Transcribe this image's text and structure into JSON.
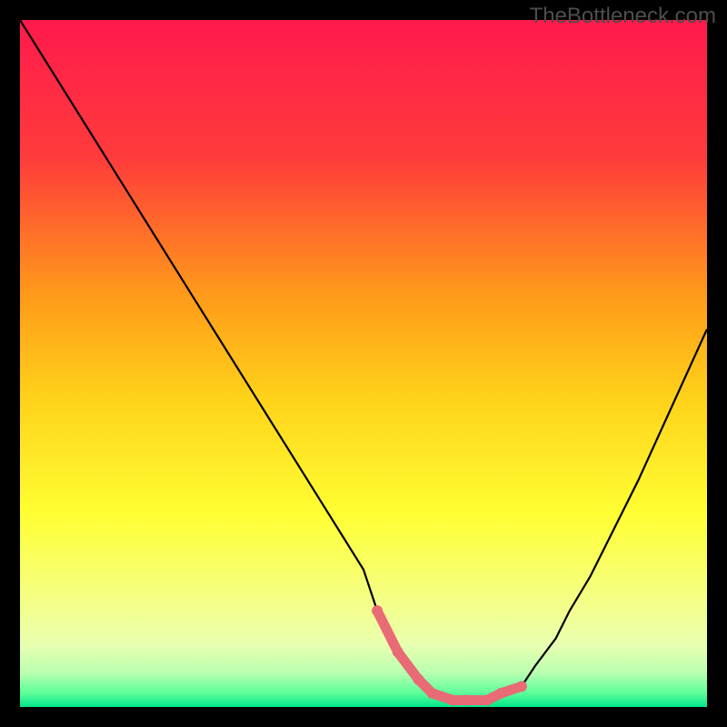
{
  "watermark": "TheBottleneck.com",
  "chart_data": {
    "type": "line",
    "title": "",
    "xlabel": "",
    "ylabel": "",
    "xlim": [
      0,
      100
    ],
    "ylim": [
      0,
      100
    ],
    "grid": false,
    "legend": false,
    "series": [
      {
        "name": "bottleneck-curve",
        "x": [
          0,
          5,
          10,
          15,
          20,
          25,
          30,
          35,
          40,
          45,
          50,
          52,
          55,
          58,
          60,
          63,
          65,
          68,
          70,
          73,
          75,
          78,
          80,
          83,
          86,
          90,
          95,
          100
        ],
        "values": [
          100,
          92,
          84,
          76,
          68,
          60,
          52,
          44,
          36,
          28,
          20,
          14,
          8,
          4,
          2,
          1,
          1,
          1,
          2,
          3,
          6,
          10,
          14,
          19,
          25,
          33,
          44,
          55
        ]
      }
    ],
    "good_zone_markers": {
      "x": [
        52,
        55,
        58,
        60,
        63,
        65,
        68,
        70,
        73
      ],
      "values": [
        14,
        8,
        4,
        2,
        1,
        1,
        1,
        2,
        3
      ]
    },
    "background_gradient_stops": [
      {
        "pos": 0.0,
        "color": "#ff1a4d"
      },
      {
        "pos": 0.2,
        "color": "#ff3b3b"
      },
      {
        "pos": 0.4,
        "color": "#ff9a1a"
      },
      {
        "pos": 0.55,
        "color": "#ffd21a"
      },
      {
        "pos": 0.72,
        "color": "#ffff33"
      },
      {
        "pos": 0.85,
        "color": "#f4ff8a"
      },
      {
        "pos": 0.91,
        "color": "#e9ffb0"
      },
      {
        "pos": 0.95,
        "color": "#baffb0"
      },
      {
        "pos": 0.98,
        "color": "#5cff9a"
      },
      {
        "pos": 1.0,
        "color": "#00e58a"
      }
    ],
    "marker_color": "#e86b75",
    "curve_color": "#000000"
  }
}
